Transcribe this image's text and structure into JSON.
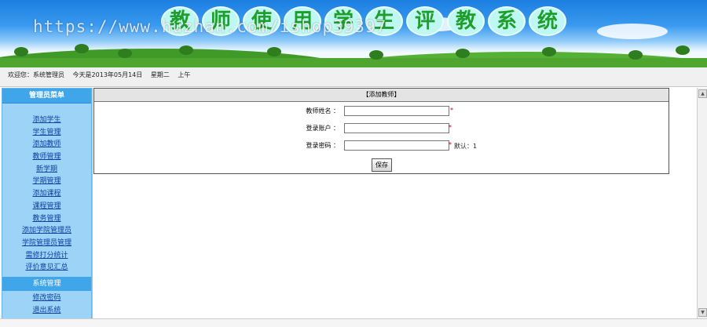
{
  "banner": {
    "title_chars": [
      "教",
      "师",
      "使",
      "用",
      "学",
      "生",
      "评",
      "教",
      "系",
      "统"
    ],
    "watermark": "https://www.huzhan.com/ishop39397"
  },
  "status": {
    "welcome": "欢迎您：系统管理员",
    "date": "今天是2013年05月14日",
    "weekday": "星期二",
    "ampm": "上午"
  },
  "sidebar": {
    "header": "管理员菜单",
    "items": [
      "添加学生",
      "学生管理",
      "添加教师",
      "教师管理",
      "新学期",
      "学期管理",
      "添加课程",
      "课程管理",
      "教务管理",
      "添加学院管理员",
      "学院管理员管理",
      "需修打分统计",
      "评价意见汇总"
    ],
    "section2": "系统管理",
    "items2": [
      "修改密码",
      "退出系统"
    ]
  },
  "form": {
    "caption": "【添加教师】",
    "teacher_name_label": "教师姓名 ：",
    "teacher_name_value": "",
    "account_label": "登录账户 ：",
    "account_value": "",
    "password_label": "登录密码 ：",
    "password_value": "",
    "required_mark": "*",
    "password_hint": "默认：1",
    "save_label": "保存"
  },
  "scrollbar": {
    "up_icon": "▲",
    "down_icon": "▼"
  }
}
